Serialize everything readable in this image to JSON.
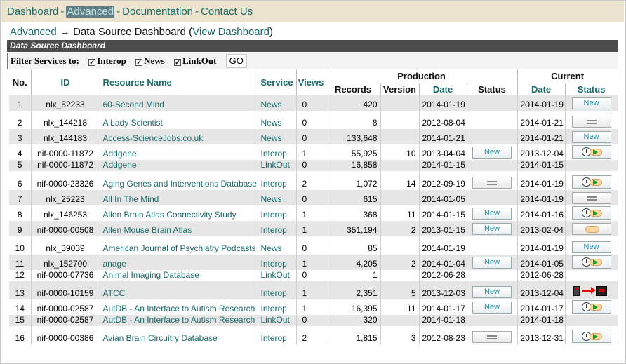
{
  "nav": {
    "items": [
      "Dashboard",
      "Advanced",
      "Documentation",
      "Contact Us"
    ],
    "active": "Advanced",
    "separator": "-"
  },
  "breadcrumb": {
    "parent": "Advanced",
    "arrow": "→",
    "current": "Data Source Dashboard",
    "open": "(",
    "link": "View Dashboard",
    "close": ")"
  },
  "panel": {
    "title": "Data Source Dashboard"
  },
  "filter": {
    "label": "Filter Services to:",
    "options": [
      {
        "label": "Interop",
        "checked": true
      },
      {
        "label": "News",
        "checked": true
      },
      {
        "label": "LinkOut",
        "checked": true
      }
    ],
    "go_label": "GO"
  },
  "table": {
    "headers": {
      "no": "No.",
      "id": "ID",
      "resource": "Resource Name",
      "service": "Service",
      "views": "Views",
      "production": "Production",
      "current": "Current",
      "records": "Records",
      "version": "Version",
      "date": "Date",
      "status": "Status",
      "cur_date": "Date",
      "cur_status": "Status"
    },
    "new_label": "New",
    "rows": [
      {
        "no": "1",
        "id": "nlx_52233",
        "name": "60-Second Mind",
        "service": "News",
        "views": "0",
        "records": "420",
        "version": "",
        "pdate": "2014-01-19",
        "pstatus": "",
        "cdate": "2014-01-19",
        "cstatus": "new"
      },
      {
        "no": "2",
        "id": "nlx_144218",
        "name": "A Lady Scientist",
        "service": "News",
        "views": "0",
        "records": "8",
        "version": "",
        "pdate": "2012-08-04",
        "pstatus": "",
        "cdate": "2014-01-21",
        "cstatus": "equal"
      },
      {
        "no": "3",
        "id": "nlx_144183",
        "name": "Access-ScienceJobs.co.uk",
        "service": "News",
        "views": "0",
        "records": "133,648",
        "version": "",
        "pdate": "2014-01-21",
        "pstatus": "",
        "cdate": "2014-01-21",
        "cstatus": "new"
      },
      {
        "no": "4",
        "id": "nif-0000-11872",
        "name": "Addgene",
        "service": "Interop",
        "views": "1",
        "records": "55,925",
        "version": "10",
        "pdate": "2013-04-04",
        "pstatus": "new",
        "cdate": "2013-12-04",
        "cstatus": "clock"
      },
      {
        "no": "5",
        "id": "nif-0000-11872",
        "name": "Addgene",
        "service": "LinkOut",
        "views": "0",
        "records": "16,858",
        "version": "",
        "pdate": "2014-01-15",
        "pstatus": "",
        "cdate": "2014-01-15",
        "cstatus": ""
      },
      {
        "no": "6",
        "id": "nif-0000-23326",
        "name": "Aging Genes and Interventions Database",
        "service": "Interop",
        "views": "2",
        "records": "1,072",
        "version": "14",
        "pdate": "2012-09-19",
        "pstatus": "equal",
        "cdate": "2014-01-19",
        "cstatus": "clock"
      },
      {
        "no": "7",
        "id": "nlx_25223",
        "name": "All In The Mind",
        "service": "News",
        "views": "0",
        "records": "615",
        "version": "",
        "pdate": "2014-01-05",
        "pstatus": "",
        "cdate": "2014-01-19",
        "cstatus": "equal"
      },
      {
        "no": "8",
        "id": "nlx_146253",
        "name": "Allen Brain Atlas Connectivity Study",
        "service": "Interop",
        "views": "1",
        "records": "368",
        "version": "11",
        "pdate": "2014-01-15",
        "pstatus": "new",
        "cdate": "2014-01-16",
        "cstatus": "clock"
      },
      {
        "no": "9",
        "id": "nif-0000-00508",
        "name": "Allen Mouse Brain Atlas",
        "service": "Interop",
        "views": "1",
        "records": "351,194",
        "version": "2",
        "pdate": "2013-01-15",
        "pstatus": "new",
        "cdate": "2013-02-04",
        "cstatus": "cloud"
      },
      {
        "no": "10",
        "id": "nlx_39039",
        "name": "American Journal of Psychiatry Podcasts",
        "service": "News",
        "views": "0",
        "records": "85",
        "version": "",
        "pdate": "2014-01-19",
        "pstatus": "",
        "cdate": "2014-01-19",
        "cstatus": "new"
      },
      {
        "no": "11",
        "id": "nlx_152700",
        "name": "anage",
        "service": "Interop",
        "views": "1",
        "records": "4,205",
        "version": "2",
        "pdate": "2014-01-04",
        "pstatus": "new",
        "cdate": "2014-01-05",
        "cstatus": "clock"
      },
      {
        "no": "12",
        "id": "nif-0000-07736",
        "name": "Animal Imaging Database",
        "service": "LinkOut",
        "views": "0",
        "records": "1",
        "version": "",
        "pdate": "2012-06-28",
        "pstatus": "",
        "cdate": "2012-06-28",
        "cstatus": ""
      },
      {
        "no": "13",
        "id": "nif-0000-10159",
        "name": "ATCC",
        "service": "Interop",
        "views": "1",
        "records": "2,351",
        "version": "5",
        "pdate": "2013-12-03",
        "pstatus": "new",
        "cdate": "2013-12-04",
        "cstatus": "transfer"
      },
      {
        "no": "14",
        "id": "nif-0000-02587",
        "name": "AutDB - An Interface to Autism Research",
        "service": "Interop",
        "views": "1",
        "records": "16,395",
        "version": "11",
        "pdate": "2014-01-17",
        "pstatus": "new",
        "cdate": "2014-01-17",
        "cstatus": "clock"
      },
      {
        "no": "15",
        "id": "nif-0000-02587",
        "name": "AutDB - An Interface to Autism Research",
        "service": "LinkOut",
        "views": "0",
        "records": "320",
        "version": "",
        "pdate": "2014-01-18",
        "pstatus": "",
        "cdate": "2014-01-18",
        "cstatus": ""
      },
      {
        "no": "16",
        "id": "nif-0000-00386",
        "name": "Avian Brain Circuitry Database",
        "service": "Interop",
        "views": "2",
        "records": "1,815",
        "version": "3",
        "pdate": "2012-08-23",
        "pstatus": "equal",
        "cdate": "2013-12-31",
        "cstatus": "clock"
      }
    ]
  },
  "colors": {
    "link": "#1a6a6a",
    "nav_bg": "#ede4cf",
    "panel_bg": "#4c4c4c",
    "row_alt": "#e6e6e6"
  }
}
